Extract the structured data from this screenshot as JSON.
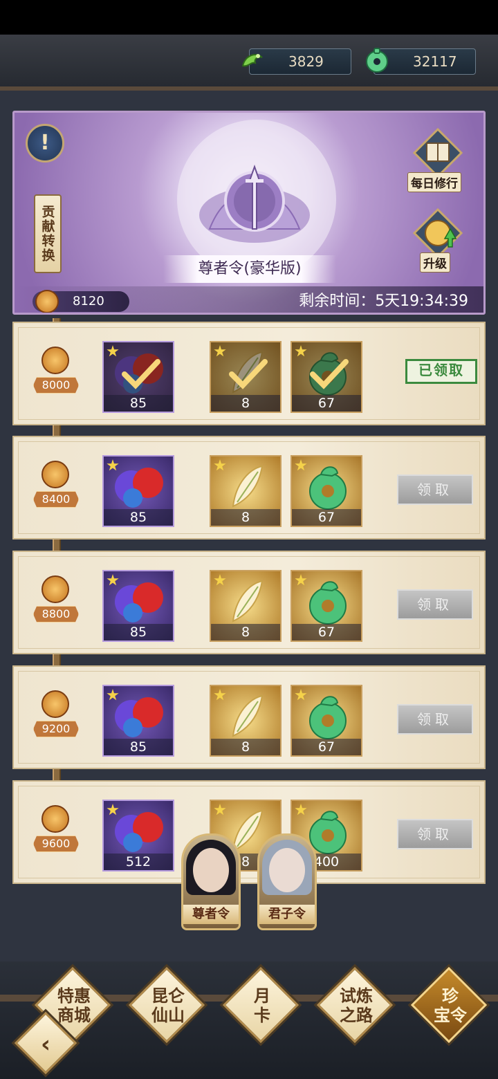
{
  "currencies": [
    {
      "icon": "jade-dragon-icon",
      "value": "3829"
    },
    {
      "icon": "jade-disc-icon",
      "value": "32117"
    }
  ],
  "banner": {
    "title": "尊者令(豪华版)",
    "contribution_exchange": "贡献转换",
    "score": "8120",
    "remaining_time": "剩余时间：5天19:34:39",
    "daily_practice": "每日修行",
    "upgrade": "升级"
  },
  "rewards": [
    {
      "threshold": "8000",
      "items": [
        {
          "count": "85"
        },
        {
          "count": "8"
        },
        {
          "count": "67"
        }
      ],
      "claimed": true,
      "status": "已领取"
    },
    {
      "threshold": "8400",
      "items": [
        {
          "count": "85"
        },
        {
          "count": "8"
        },
        {
          "count": "67"
        }
      ],
      "claimed": false,
      "status": "领取"
    },
    {
      "threshold": "8800",
      "items": [
        {
          "count": "85"
        },
        {
          "count": "8"
        },
        {
          "count": "67"
        }
      ],
      "claimed": false,
      "status": "领取"
    },
    {
      "threshold": "9200",
      "items": [
        {
          "count": "85"
        },
        {
          "count": "8"
        },
        {
          "count": "67"
        }
      ],
      "claimed": false,
      "status": "领取"
    },
    {
      "threshold": "9600",
      "items": [
        {
          "count": "512"
        },
        {
          "count": "8"
        },
        {
          "count": "400"
        }
      ],
      "claimed": false,
      "status": "领取"
    }
  ],
  "characters": [
    {
      "label": "尊者令"
    },
    {
      "label": "君子令"
    }
  ],
  "nav": [
    {
      "label": "特惠商城",
      "active": false
    },
    {
      "label": "昆仑仙山",
      "active": false
    },
    {
      "label": "月卡",
      "active": false
    },
    {
      "label": "试炼之路",
      "active": false
    },
    {
      "label": "珍宝令",
      "active": true
    }
  ],
  "colors": {
    "claimed_green": "#3b8a3e",
    "banner_purple": "#8c6aaf",
    "gold_accent": "#c9a060"
  }
}
